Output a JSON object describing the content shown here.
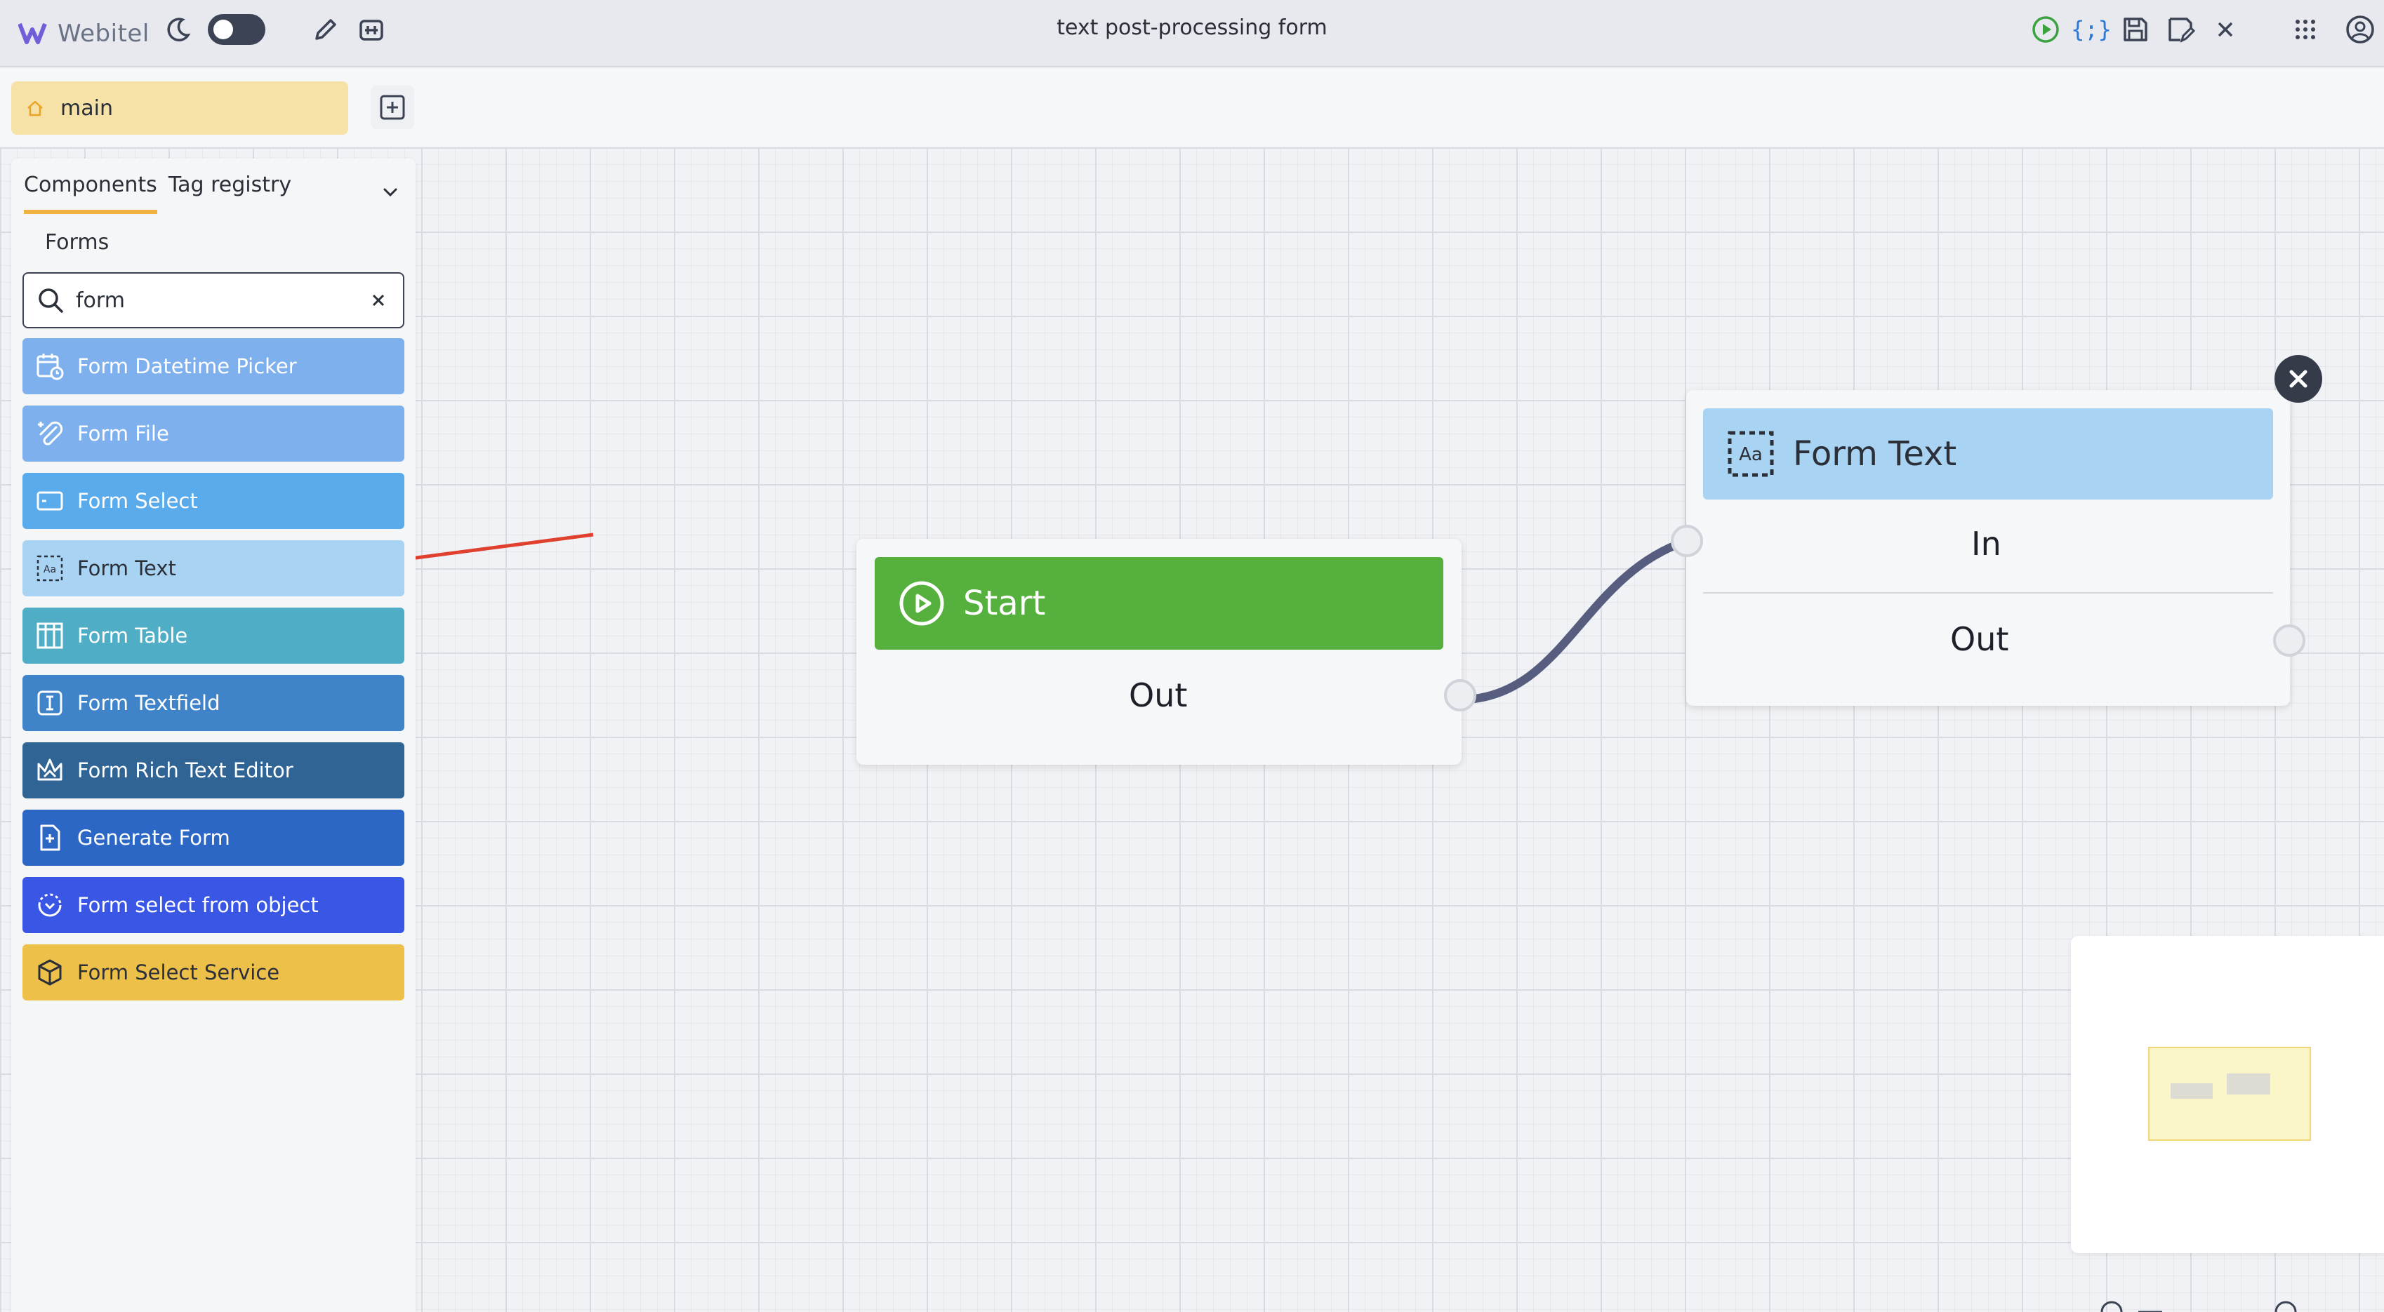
{
  "app": {
    "brand": "Webitel",
    "title": "text post-processing form"
  },
  "tabs": {
    "main_label": "main"
  },
  "panel": {
    "tabs": [
      "Components",
      "Tag registry"
    ],
    "category": "Forms",
    "search": {
      "value": "form",
      "placeholder": ""
    },
    "components": [
      {
        "label": "Form Datetime Picker",
        "color": "#7fb0ee",
        "icon": "calendar-clock-icon"
      },
      {
        "label": "Form File",
        "color": "#7fb0ee",
        "icon": "paperclip-icon"
      },
      {
        "label": "Form Select",
        "color": "#5aabeb",
        "icon": "select-box-icon"
      },
      {
        "label": "Form Text",
        "color": "#a9d3f3",
        "icon": "text-frame-icon"
      },
      {
        "label": "Form Table",
        "color": "#4fadc5",
        "icon": "table-icon"
      },
      {
        "label": "Form Textfield",
        "color": "#3f84c8",
        "icon": "text-cursor-icon"
      },
      {
        "label": "Form Rich Text Editor",
        "color": "#2f6494",
        "icon": "crown-icon"
      },
      {
        "label": "Generate Form",
        "color": "#2c67c5",
        "icon": "document-plus-icon"
      },
      {
        "label": "Form select from object",
        "color": "#3a56e5",
        "icon": "circle-chevron-icon"
      },
      {
        "label": "Form Select Service",
        "color": "#edc04a",
        "icon": "cube-icon"
      }
    ]
  },
  "nodes": {
    "start": {
      "title": "Start",
      "out_label": "Out",
      "head_color": "#55b03e"
    },
    "form_text": {
      "title": "Form Text",
      "in_label": "In",
      "out_label": "Out",
      "head_color": "#a9d3f3"
    }
  },
  "colors": {
    "accent_tab": "#f0b341",
    "connector": "#565d7e",
    "annotation_arrow": "#e0402e"
  }
}
